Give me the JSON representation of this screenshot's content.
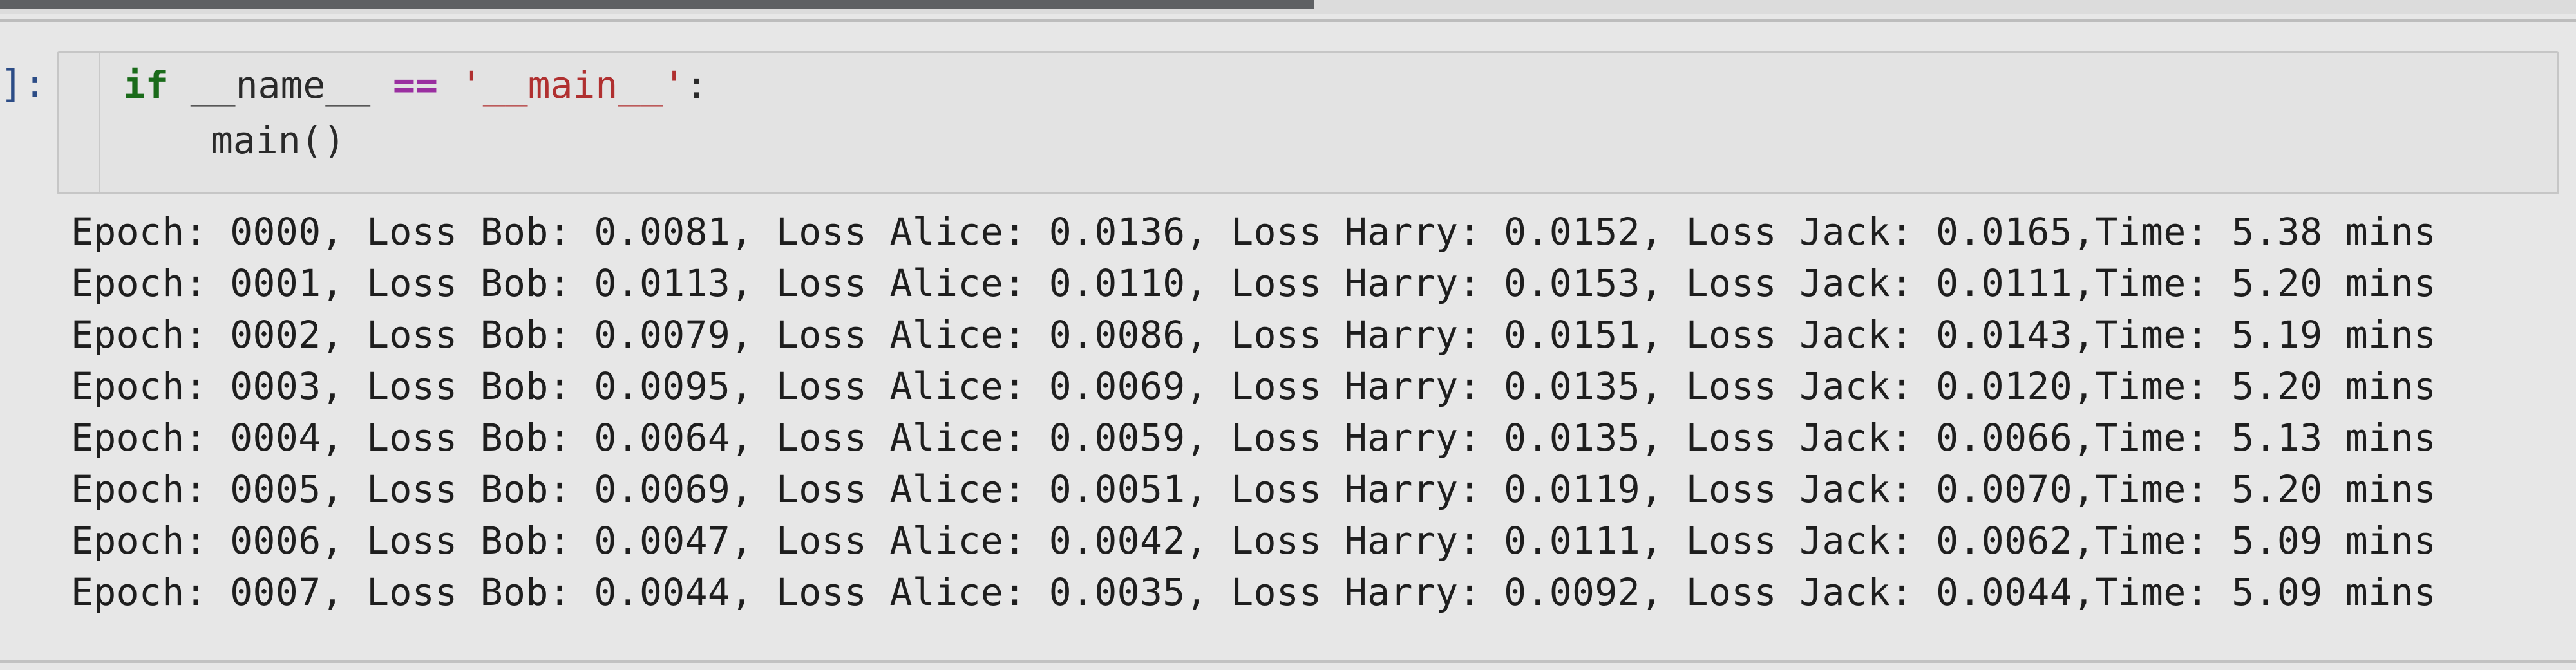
{
  "cell": {
    "prompt": "]:",
    "code": {
      "line1": {
        "kw": "if",
        "name": "__name__",
        "op": "==",
        "str": "'__main__'",
        "colon": ":"
      },
      "line2": "main()"
    }
  },
  "output": {
    "lines": [
      "Epoch: 0000, Loss Bob: 0.0081, Loss Alice: 0.0136, Loss Harry: 0.0152, Loss Jack: 0.0165,Time: 5.38 mins",
      "Epoch: 0001, Loss Bob: 0.0113, Loss Alice: 0.0110, Loss Harry: 0.0153, Loss Jack: 0.0111,Time: 5.20 mins",
      "Epoch: 0002, Loss Bob: 0.0079, Loss Alice: 0.0086, Loss Harry: 0.0151, Loss Jack: 0.0143,Time: 5.19 mins",
      "Epoch: 0003, Loss Bob: 0.0095, Loss Alice: 0.0069, Loss Harry: 0.0135, Loss Jack: 0.0120,Time: 5.20 mins",
      "Epoch: 0004, Loss Bob: 0.0064, Loss Alice: 0.0059, Loss Harry: 0.0135, Loss Jack: 0.0066,Time: 5.13 mins",
      "Epoch: 0005, Loss Bob: 0.0069, Loss Alice: 0.0051, Loss Harry: 0.0119, Loss Jack: 0.0070,Time: 5.20 mins",
      "Epoch: 0006, Loss Bob: 0.0047, Loss Alice: 0.0042, Loss Harry: 0.0111, Loss Jack: 0.0062,Time: 5.09 mins",
      "Epoch: 0007, Loss Bob: 0.0044, Loss Alice: 0.0035, Loss Harry: 0.0092, Loss Jack: 0.0044,Time: 5.09 mins"
    ]
  },
  "colors": {
    "keyword": "#1a6b1a",
    "operator": "#9a2fa0",
    "string": "#b03030",
    "prompt": "#2c4c86"
  }
}
